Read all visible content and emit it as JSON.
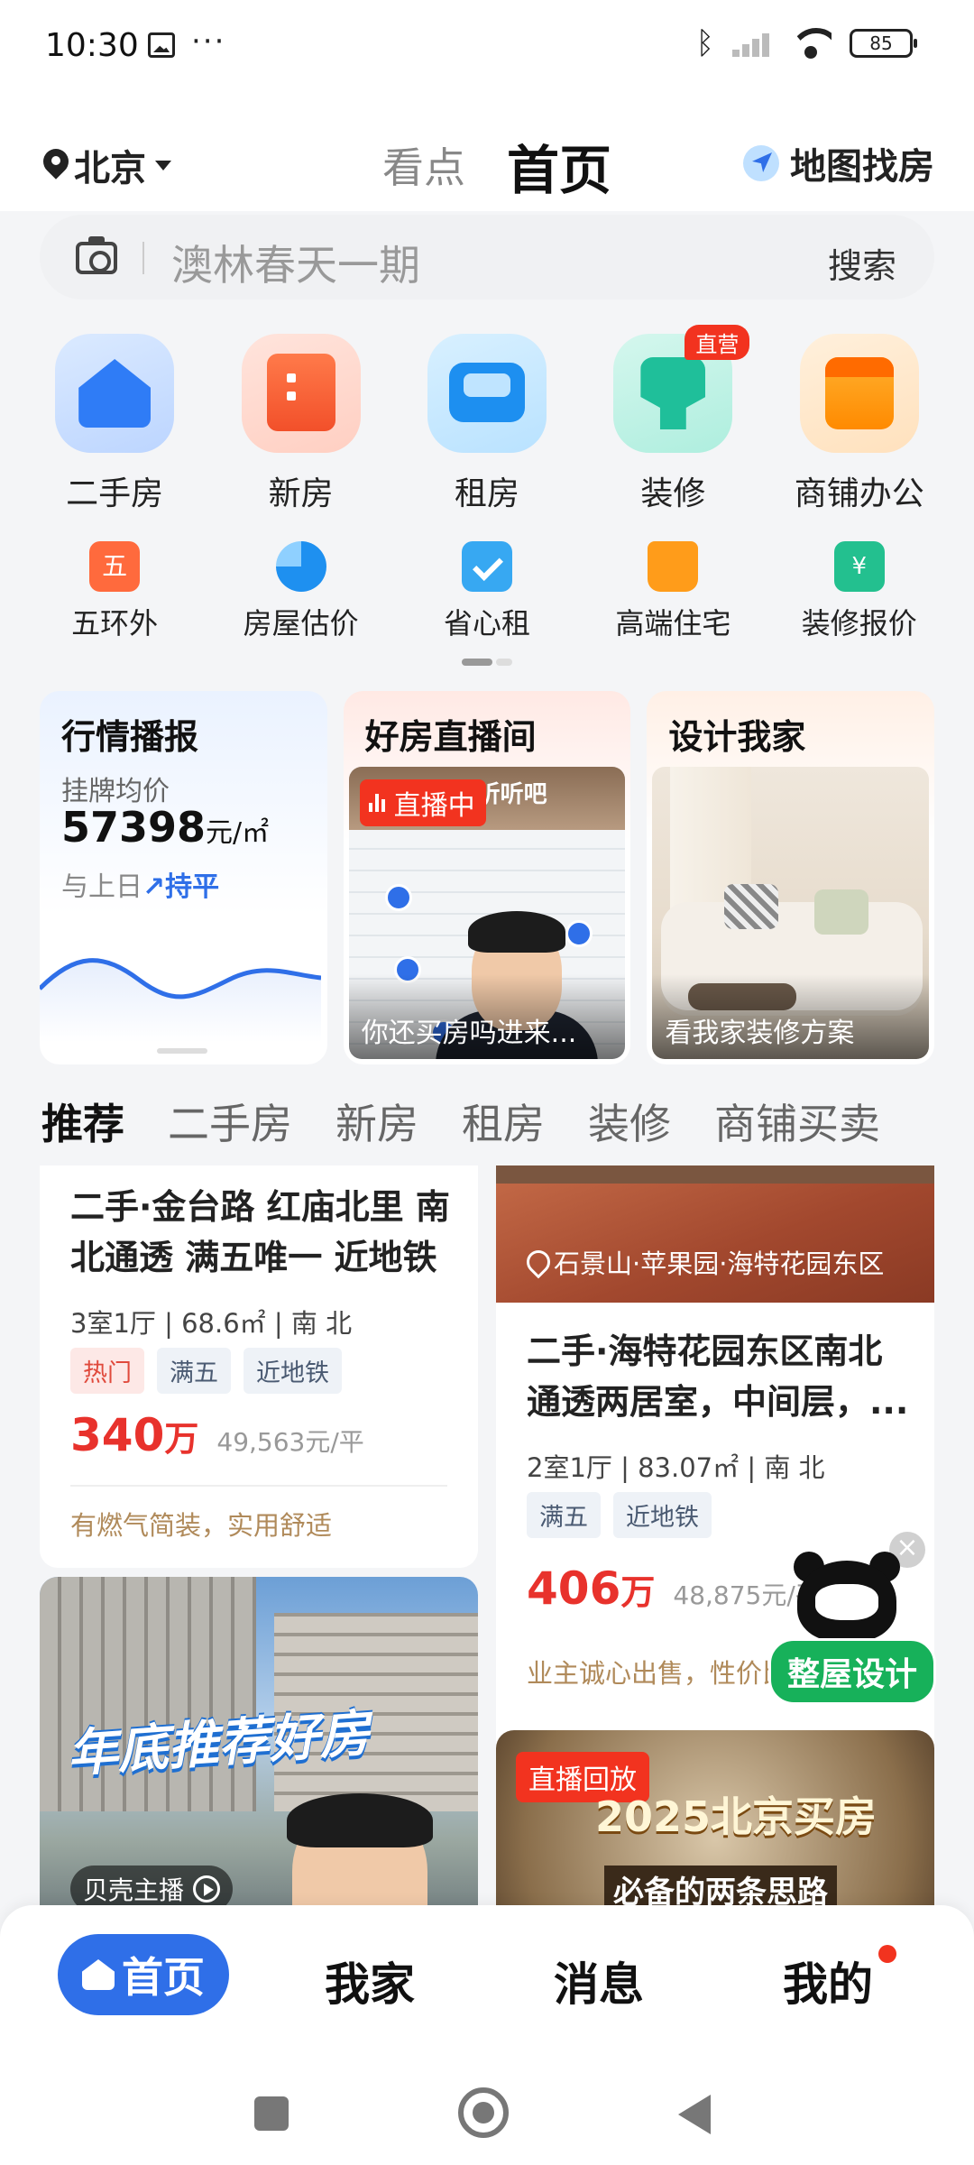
{
  "status_bar": {
    "time": "10:30",
    "more": "···",
    "battery": "85"
  },
  "header": {
    "city": "北京",
    "tab_look": "看点",
    "tab_home": "首页",
    "map_find": "地图找房"
  },
  "search": {
    "placeholder": "澳林春天一期",
    "button": "搜索"
  },
  "main_grid": [
    {
      "label": "二手房",
      "icon": "house-icon"
    },
    {
      "label": "新房",
      "icon": "building-icon"
    },
    {
      "label": "租房",
      "icon": "sofa-icon"
    },
    {
      "label": "装修",
      "icon": "chair-icon",
      "badge": "直营"
    },
    {
      "label": "商铺办公",
      "icon": "shop-icon"
    }
  ],
  "sub_grid": [
    {
      "label": "五环外",
      "icon_text": "五"
    },
    {
      "label": "房屋估价"
    },
    {
      "label": "省心租"
    },
    {
      "label": "高端住宅"
    },
    {
      "label": "装修报价",
      "icon_text": "¥"
    }
  ],
  "cards": {
    "market": {
      "title": "行情播报",
      "label": "挂牌均价",
      "price": "57398",
      "unit": "元/㎡",
      "compare_prefix": "与上日",
      "compare_arrow": "↗",
      "compare_value": "持平"
    },
    "live": {
      "title": "好房直播间",
      "badge": "直播中",
      "banner": "进来听听吧",
      "caption": "你还买房吗进来..."
    },
    "design": {
      "title": "设计我家",
      "caption": "看我家装修方案"
    }
  },
  "category_tabs": [
    "推荐",
    "二手房",
    "新房",
    "租房",
    "装修",
    "商铺买卖"
  ],
  "feed": {
    "left_1": {
      "title_line1": "二手·金台路 红庙北里 南",
      "title_line2": "北通透 满五唯一 近地铁",
      "meta": "3室1厅 | 68.6㎡ | 南 北",
      "tags": [
        "热门",
        "满五",
        "近地铁"
      ],
      "price": "340",
      "price_suffix": "万",
      "unit_price": "49,563元/平",
      "desc": "有燃气简装，实用舒适"
    },
    "right_1": {
      "location": "石景山·苹果园·海特花园东区",
      "title_line1": "二手·海特花园东区南北",
      "title_line2": "通透两居室，中间层，...",
      "meta": "2室1厅 | 83.07㎡ | 南 北",
      "tags": [
        "满五",
        "近地铁"
      ],
      "price": "406",
      "price_suffix": "万",
      "unit_price": "48,875元/平",
      "desc": "业主诚心出售，性价比高"
    },
    "left_2": {
      "title": "年底推荐好房",
      "host": "贝壳主播"
    },
    "right_2": {
      "badge": "直播回放",
      "title": "2025北京买房",
      "subtitle": "必备的两条思路"
    }
  },
  "float_promo": {
    "close": "×",
    "button": "整屋设计"
  },
  "bottom_nav": {
    "home": "首页",
    "my_home": "我家",
    "messages": "消息",
    "mine": "我的"
  },
  "colors": {
    "brand_blue": "#2f6fe8",
    "price_red": "#e8322c",
    "live_red": "#f2331f",
    "promo_green": "#17b15a"
  }
}
